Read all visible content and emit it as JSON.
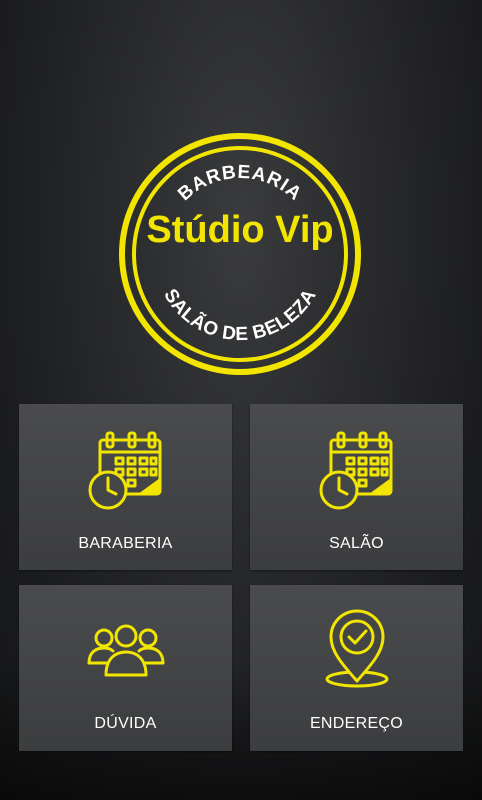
{
  "logo": {
    "top_text": "BARBEARIA",
    "name": "Stúdio Vip",
    "bottom_text": "SALÃO DE BELEZA"
  },
  "menu": [
    {
      "label": "BARABERIA",
      "icon": "calendar-clock-icon"
    },
    {
      "label": "SALÃO",
      "icon": "calendar-clock-icon"
    },
    {
      "label": "DÚVIDA",
      "icon": "group-icon"
    },
    {
      "label": "ENDEREÇO",
      "icon": "location-check-icon"
    }
  ],
  "colors": {
    "accent": "#f2e600",
    "tile": "#444547",
    "background": "#252628",
    "text": "#ffffff"
  }
}
